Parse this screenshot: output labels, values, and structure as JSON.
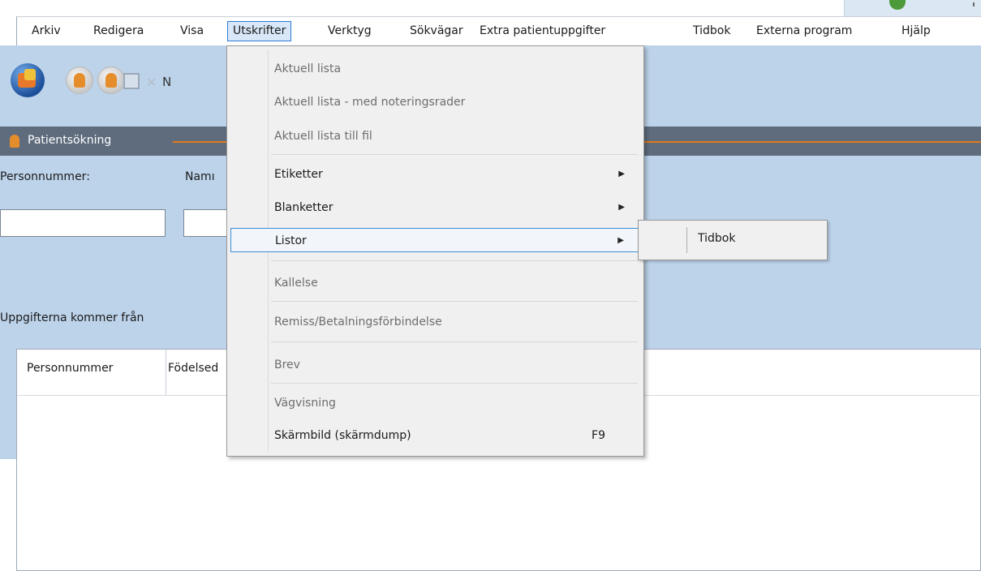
{
  "menubar": {
    "items": [
      "Arkiv",
      "Redigera",
      "Visa",
      "Utskrifter",
      "Verktyg",
      "Sökvägar",
      "Extra patientuppgifter",
      "Tidbok",
      "Externa program",
      "Hjälp"
    ],
    "active": "Utskrifter"
  },
  "toolbar": {
    "icons": [
      "puzzle-app-icon",
      "patient-search-icon",
      "patient-icon",
      "save-icon",
      "delete-icon"
    ],
    "truncated_label": "N"
  },
  "panel": {
    "title": "Patientsökning",
    "personnummer_label": "Personnummer:",
    "namn_label_partial": "Namı",
    "source_text_partial": "Uppgifterna kommer från",
    "columns": [
      "Personnummer",
      "Födelsed"
    ]
  },
  "dropdown": {
    "items": [
      {
        "label": "Aktuell lista",
        "enabled": false
      },
      {
        "label": "Aktuell lista - med noteringsrader",
        "enabled": false
      },
      {
        "label": "Aktuell lista till fil",
        "enabled": false
      },
      {
        "label": "Etiketter",
        "enabled": true,
        "submenu": true
      },
      {
        "label": "Blanketter",
        "enabled": true,
        "submenu": true
      },
      {
        "label": "Listor",
        "enabled": true,
        "submenu": true,
        "highlighted": true
      },
      {
        "label": "Kallelse",
        "enabled": false
      },
      {
        "label": "Remiss/Betalningsförbindelse",
        "enabled": false
      },
      {
        "label": "Brev",
        "enabled": false
      },
      {
        "label": "Vägvisning",
        "enabled": false
      },
      {
        "label": "Skärmbild (skärmdump)",
        "enabled": true,
        "shortcut": "F9"
      }
    ]
  },
  "submenu": {
    "items": [
      "Tidbok"
    ]
  },
  "colors": {
    "app_background": "#bdd3ea",
    "header_bar": "#5f6c7d",
    "accent_line": "#e17a16",
    "menu_highlight_border": "#3c8fd6"
  }
}
